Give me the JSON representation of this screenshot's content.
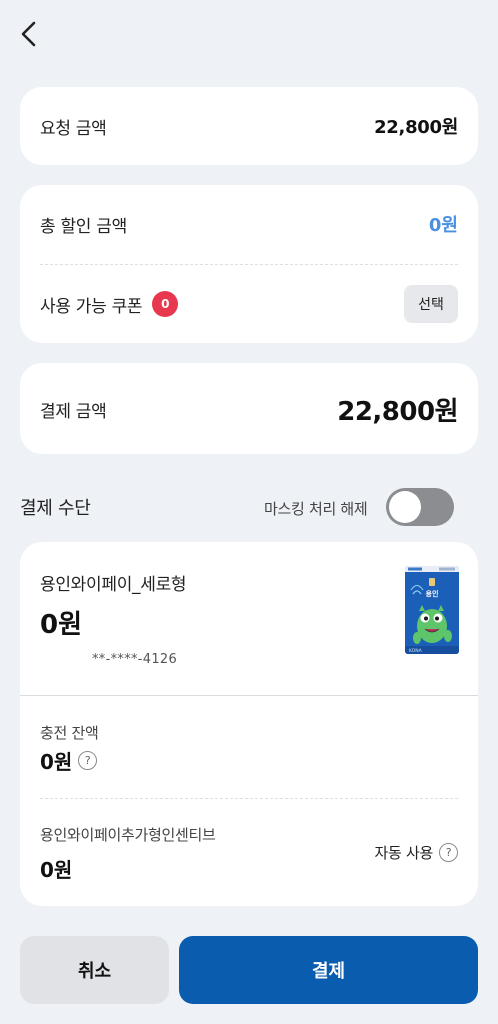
{
  "nav": {
    "back_icon": "chevron-left-icon"
  },
  "request": {
    "label": "요청 금액",
    "amount": "22,800원"
  },
  "discount": {
    "total_label": "총 할인 금액",
    "total_amount": "0원",
    "coupon_label": "사용 가능 쿠폰",
    "coupon_count": "0",
    "select_label": "선택"
  },
  "payment_amount": {
    "label": "결제 금액",
    "amount": "22,800원"
  },
  "payment_method": {
    "title": "결제 수단",
    "mask_label": "마스킹 처리 해제",
    "mask_enabled": false
  },
  "pay_card": {
    "name": "용인와이페이_세로형",
    "balance": "0원",
    "number": "**-****-4126"
  },
  "charge": {
    "label": "충전 잔액",
    "amount": "0원",
    "help": "?"
  },
  "incentive": {
    "label": "용인와이페이추가형인센티브",
    "amount": "0원",
    "auto_label": "자동 사용",
    "help": "?"
  },
  "actions": {
    "cancel": "취소",
    "pay": "결제"
  },
  "colors": {
    "background": "#eef1f6",
    "primary": "#0a5cae",
    "discount_blue": "#4a8fe0",
    "badge_red": "#e8384f",
    "toggle_off": "#8b8d91"
  }
}
